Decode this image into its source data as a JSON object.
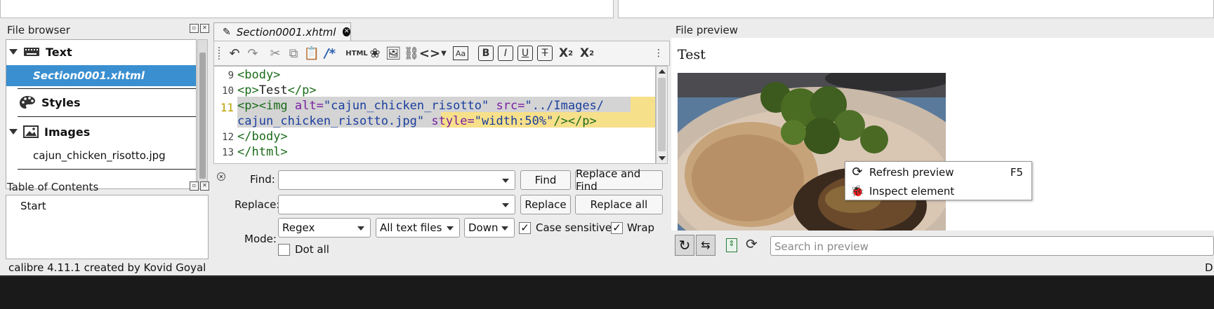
{
  "top_inputs": {},
  "file_browser": {
    "title": "File browser",
    "groups": [
      {
        "label": "Text"
      },
      {
        "label": "Styles"
      },
      {
        "label": "Images"
      }
    ],
    "files": {
      "text_file": "Section0001.xhtml",
      "image_file": "cajun_chicken_risotto.jpg"
    }
  },
  "toc": {
    "title": "Table of Contents",
    "items": [
      "Start"
    ]
  },
  "editor": {
    "tab_label": "Section0001.xhtml",
    "lines": [
      {
        "num": "9",
        "parts": [
          {
            "c": "tag",
            "t": "<body>"
          }
        ]
      },
      {
        "num": "10",
        "parts": [
          {
            "c": "tag",
            "t": "<p>"
          },
          {
            "c": "txt",
            "t": "Test"
          },
          {
            "c": "tag",
            "t": "</p>"
          }
        ]
      },
      {
        "num": "11",
        "parts": [
          {
            "c": "tag",
            "t": "<p>"
          },
          {
            "c": "tag",
            "t": "<img "
          },
          {
            "c": "attr",
            "t": "alt="
          },
          {
            "c": "str",
            "t": "\"cajun_chicken_risotto\" "
          },
          {
            "c": "attr",
            "t": "src="
          },
          {
            "c": "str",
            "t": "\"../Images/"
          }
        ]
      },
      {
        "num": "",
        "parts": [
          {
            "c": "str",
            "t": "cajun_chicken_risotto.jpg\" "
          },
          {
            "c": "attr",
            "t": "style="
          },
          {
            "c": "str",
            "t": "\"width:50%\""
          },
          {
            "c": "tag",
            "t": "/></p>"
          }
        ]
      },
      {
        "num": "12",
        "parts": [
          {
            "c": "tag",
            "t": "</body>"
          }
        ]
      },
      {
        "num": "13",
        "parts": [
          {
            "c": "tag",
            "t": "</html>"
          }
        ]
      }
    ]
  },
  "find_replace": {
    "find_label": "Find:",
    "replace_label": "Replace:",
    "mode_label": "Mode:",
    "find_button": "Find",
    "replace_and_find_button": "Replace and Find",
    "replace_button": "Replace",
    "replace_all_button": "Replace all",
    "mode_value": "Regex",
    "scope_value": "All text files",
    "direction_value": "Down",
    "case_sensitive_label": "Case sensitive",
    "wrap_label": "Wrap",
    "dot_all_label": "Dot all",
    "case_sensitive_checked": true,
    "wrap_checked": true,
    "dot_all_checked": false
  },
  "preview": {
    "title": "File preview",
    "heading": "Test",
    "search_placeholder": "Search in preview",
    "context_menu": [
      {
        "label": "Refresh preview",
        "shortcut": "F5"
      },
      {
        "label": "Inspect element",
        "shortcut": ""
      }
    ]
  },
  "status": {
    "text": "calibre 4.11.1 created by Kovid Goyal",
    "right_text": "D"
  },
  "colors": {
    "selection": "#3a8fd0",
    "highlight_line": "#f7e08a",
    "selection_gray": "#d4d4d4"
  }
}
